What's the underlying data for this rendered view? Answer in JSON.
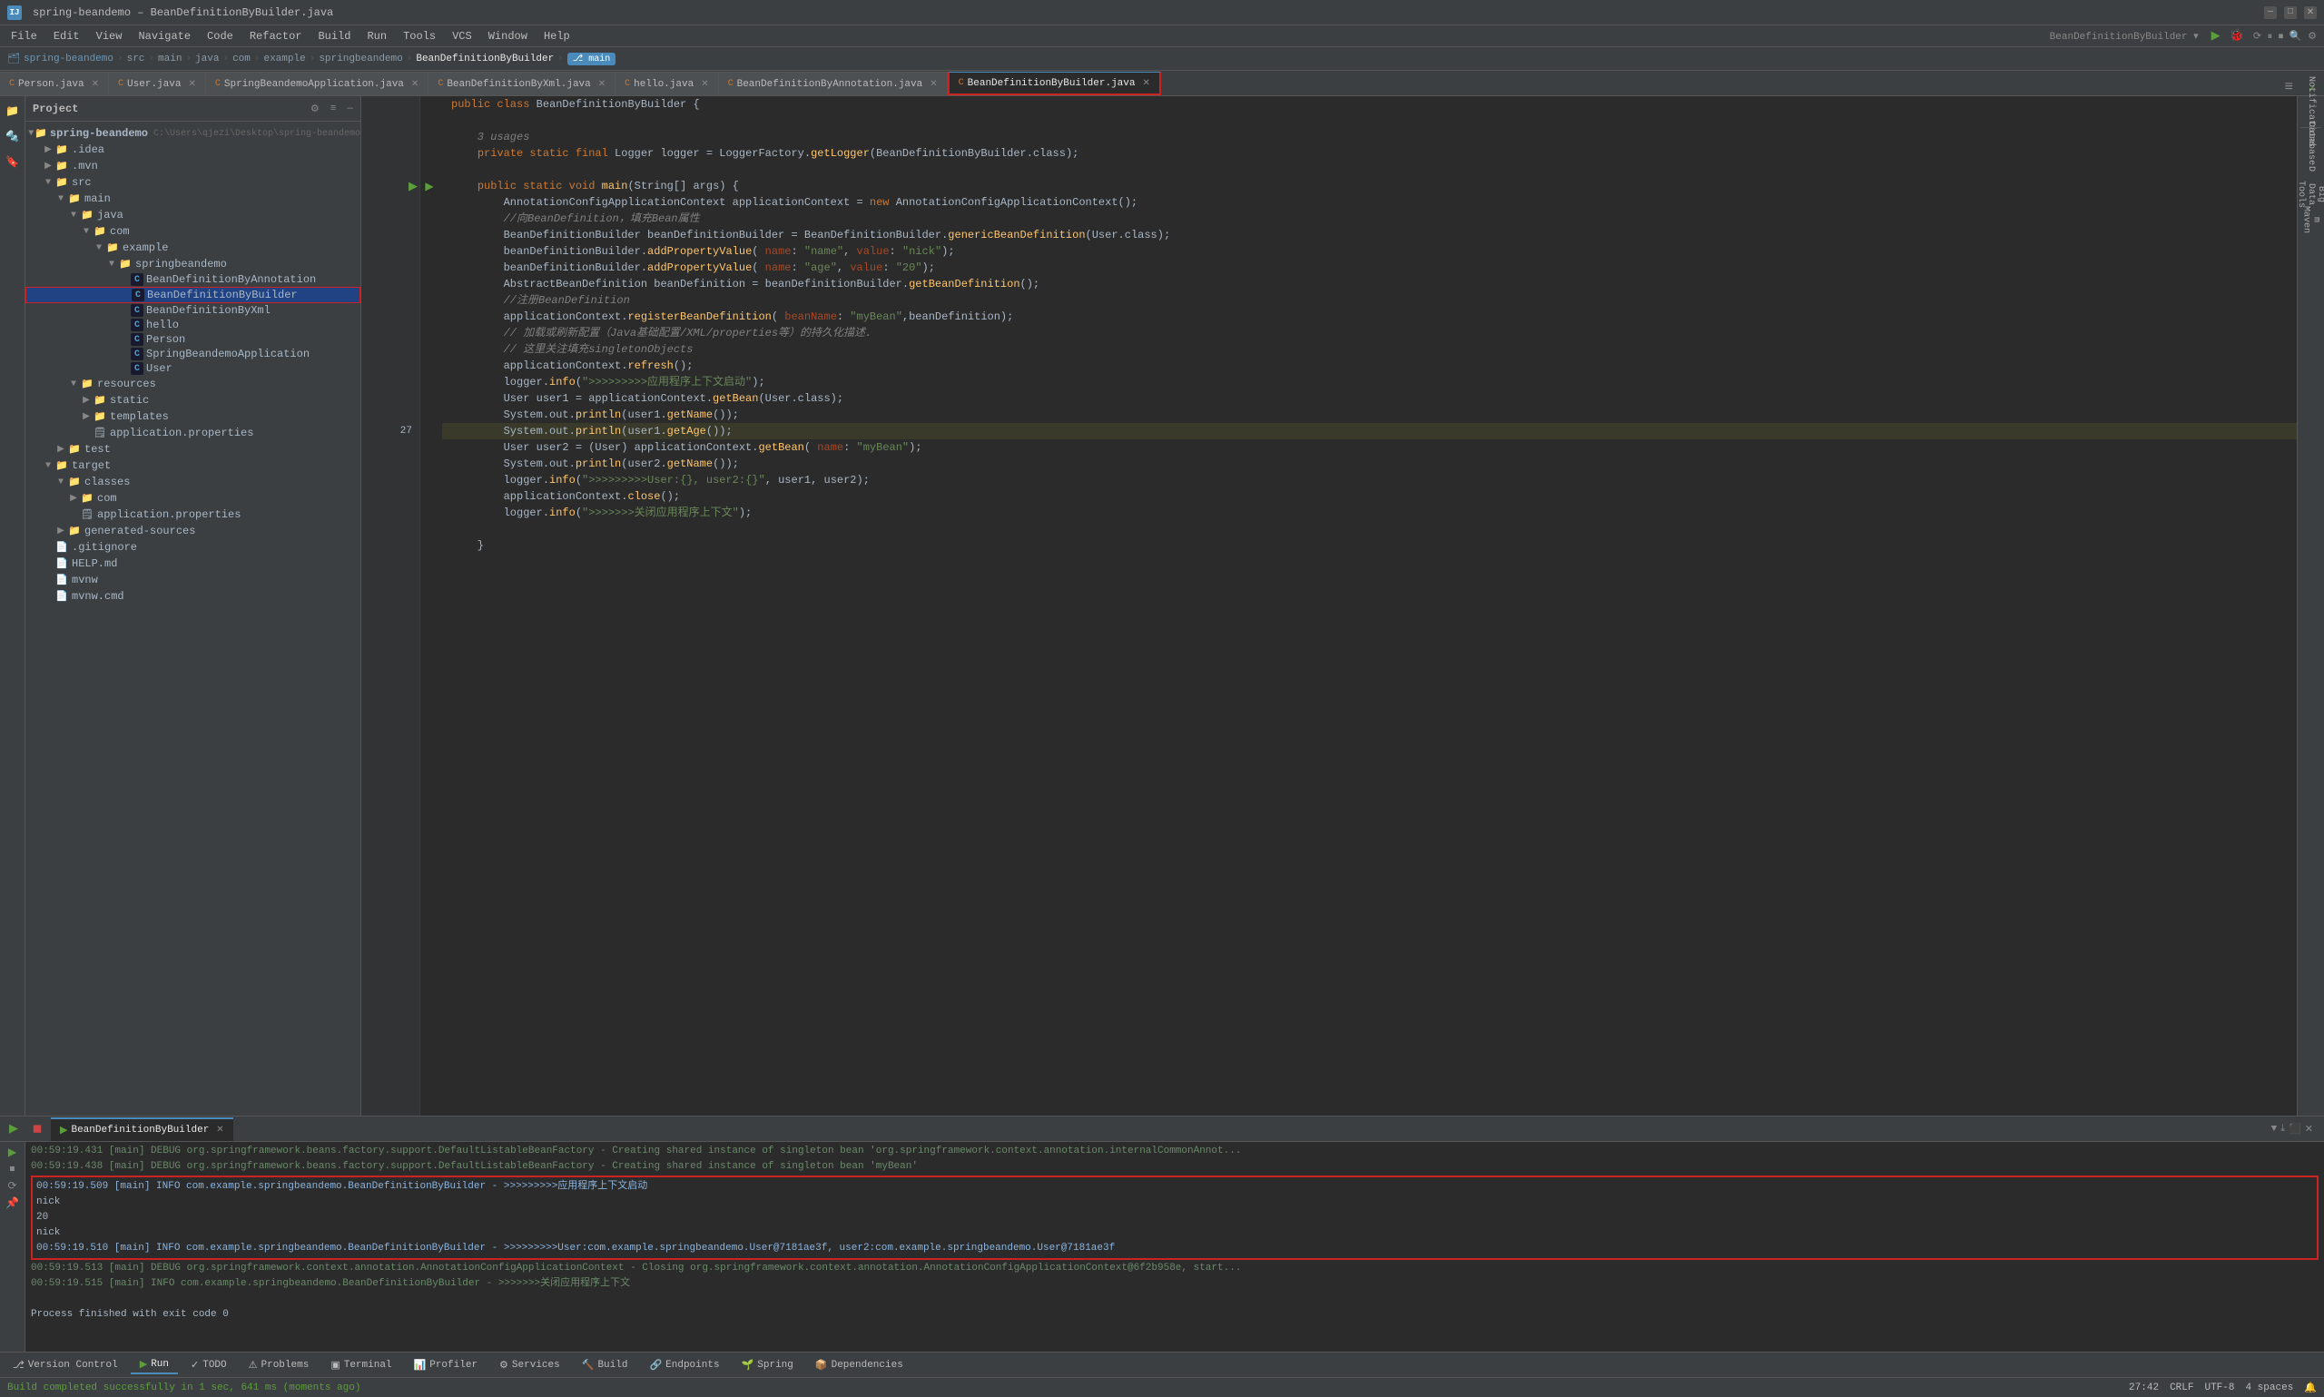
{
  "titlebar": {
    "app_name": "spring-beandemo",
    "file_name": "BeanDefinitionByBuilder.java",
    "title": "spring-beandemo – BeanDefinitionByBuilder.java",
    "minimize": "—",
    "maximize": "□",
    "close": "✕"
  },
  "menubar": {
    "items": [
      "File",
      "Edit",
      "View",
      "Navigate",
      "Code",
      "Refactor",
      "Build",
      "Run",
      "Tools",
      "VCS",
      "Window",
      "Help"
    ]
  },
  "navbar": {
    "path": [
      "spring-beandemo",
      "src",
      "main",
      "java",
      "com",
      "example",
      "springbeandemo"
    ],
    "active": "BeanDefinitionByBuilder",
    "branch": "main"
  },
  "tabs": [
    {
      "label": "Person.java",
      "active": false
    },
    {
      "label": "User.java",
      "active": false
    },
    {
      "label": "SpringBeandemoApplication.java",
      "active": false
    },
    {
      "label": "BeanDefinitionByXml.java",
      "active": false
    },
    {
      "label": "hello.java",
      "active": false
    },
    {
      "label": "BeanDefinitionByAnnotation.java",
      "active": false
    },
    {
      "label": "BeanDefinitionByBuilder.java",
      "active": true
    }
  ],
  "sidebar": {
    "header": "Project",
    "tree": [
      {
        "level": 0,
        "label": "spring-beandemo",
        "type": "root",
        "path": "C:\\Users\\qjezi\\Desktop\\spring-beandemo",
        "expanded": true
      },
      {
        "level": 1,
        "label": ".idea",
        "type": "folder",
        "expanded": false
      },
      {
        "level": 1,
        "label": ".mvn",
        "type": "folder",
        "expanded": false
      },
      {
        "level": 1,
        "label": "src",
        "type": "folder",
        "expanded": true
      },
      {
        "level": 2,
        "label": "main",
        "type": "folder",
        "expanded": true
      },
      {
        "level": 3,
        "label": "java",
        "type": "folder",
        "expanded": true
      },
      {
        "level": 4,
        "label": "com",
        "type": "folder",
        "expanded": true
      },
      {
        "level": 5,
        "label": "example",
        "type": "folder",
        "expanded": true
      },
      {
        "level": 6,
        "label": "springbeandemo",
        "type": "folder",
        "expanded": true
      },
      {
        "level": 7,
        "label": "BeanDefinitionByAnnotation",
        "type": "class",
        "icon": "C"
      },
      {
        "level": 7,
        "label": "BeanDefinitionByBuilder",
        "type": "class",
        "icon": "C",
        "selected": true,
        "focused": true
      },
      {
        "level": 7,
        "label": "BeanDefinitionByXml",
        "type": "class",
        "icon": "C"
      },
      {
        "level": 7,
        "label": "hello",
        "type": "class",
        "icon": "C"
      },
      {
        "level": 7,
        "label": "Person",
        "type": "class",
        "icon": "C"
      },
      {
        "level": 7,
        "label": "SpringBeandemoApplication",
        "type": "class",
        "icon": "C"
      },
      {
        "level": 7,
        "label": "User",
        "type": "class",
        "icon": "C"
      },
      {
        "level": 3,
        "label": "resources",
        "type": "folder",
        "expanded": true
      },
      {
        "level": 4,
        "label": "static",
        "type": "folder",
        "expanded": false
      },
      {
        "level": 4,
        "label": "templates",
        "type": "folder",
        "expanded": false
      },
      {
        "level": 4,
        "label": "application.properties",
        "type": "props"
      },
      {
        "level": 2,
        "label": "test",
        "type": "folder",
        "expanded": false
      },
      {
        "level": 1,
        "label": "target",
        "type": "folder",
        "expanded": true
      },
      {
        "level": 2,
        "label": "classes",
        "type": "folder",
        "expanded": true
      },
      {
        "level": 3,
        "label": "com",
        "type": "folder",
        "expanded": false
      },
      {
        "level": 3,
        "label": "application.properties",
        "type": "props"
      },
      {
        "level": 2,
        "label": "generated-sources",
        "type": "folder",
        "expanded": false
      },
      {
        "level": 1,
        "label": ".gitignore",
        "type": "file"
      },
      {
        "level": 1,
        "label": "HELP.md",
        "type": "file"
      },
      {
        "level": 1,
        "label": "mvnw",
        "type": "file"
      },
      {
        "level": 1,
        "label": "mvnw.cmd",
        "type": "file"
      }
    ]
  },
  "editor": {
    "filename": "BeanDefinitionByBuilder.java",
    "lines": [
      {
        "num": "",
        "content": "public class BeanDefinitionByBuilder {",
        "arrow": false
      },
      {
        "num": "",
        "content": "",
        "arrow": false
      },
      {
        "num": "",
        "content": "    3 usages",
        "arrow": false,
        "comment": true
      },
      {
        "num": "",
        "content": "    private static final Logger logger = LoggerFactory.getLogger(BeanDefinitionByBuilder.class);",
        "arrow": false
      },
      {
        "num": "",
        "content": "",
        "arrow": false
      },
      {
        "num": "",
        "content": "    public static void main(String[] args) {",
        "arrow": true
      },
      {
        "num": "",
        "content": "        AnnotationConfigApplicationContext applicationContext = new AnnotationConfigApplicationContext();",
        "arrow": false
      },
      {
        "num": "",
        "content": "        //向BeanDefinition，填充Bean属性",
        "arrow": false,
        "comment": true
      },
      {
        "num": "",
        "content": "        BeanDefinitionBuilder beanDefinitionBuilder = BeanDefinitionBuilder.genericBeanDefinition(User.class);",
        "arrow": false
      },
      {
        "num": "",
        "content": "        beanDefinitionBuilder.addPropertyValue( name: \"name\", value: \"nick\");",
        "arrow": false
      },
      {
        "num": "",
        "content": "        beanDefinitionBuilder.addPropertyValue( name: \"age\", value: \"20\");",
        "arrow": false
      },
      {
        "num": "",
        "content": "        AbstractBeanDefinition beanDefinition = beanDefinitionBuilder.getBeanDefinition();",
        "arrow": false
      },
      {
        "num": "",
        "content": "        //注册BeanDefinition",
        "arrow": false,
        "comment": true
      },
      {
        "num": "",
        "content": "        applicationContext.registerBeanDefinition( beanName: \"myBean\",beanDefinition);",
        "arrow": false
      },
      {
        "num": "",
        "content": "        // 加载或刷新配置（Java基础配置/XML/properties等）的持久化描述.",
        "arrow": false,
        "comment": true
      },
      {
        "num": "",
        "content": "        // 这里关注填充singletonObjects",
        "arrow": false,
        "comment": true
      },
      {
        "num": "",
        "content": "        applicationContext.refresh();",
        "arrow": false
      },
      {
        "num": "",
        "content": "        logger.info(\">>>>>>>>>应用程序上下文启动\");",
        "arrow": false
      },
      {
        "num": "",
        "content": "        User user1 = applicationContext.getBean(User.class);",
        "arrow": false
      },
      {
        "num": "",
        "content": "        System.out.println(user1.getName());",
        "arrow": false
      },
      {
        "num": "27",
        "content": "        System.out.println(user1.getAge());",
        "arrow": false,
        "highlight": true
      },
      {
        "num": "",
        "content": "        User user2 = (User) applicationContext.getBean( name: \"myBean\");",
        "arrow": false
      },
      {
        "num": "",
        "content": "        System.out.println(user2.getName());",
        "arrow": false
      },
      {
        "num": "",
        "content": "        logger.info(\">>>>>>>>>User:{}, user2:{}\", user1, user2);",
        "arrow": false
      },
      {
        "num": "",
        "content": "        applicationContext.close();",
        "arrow": false
      },
      {
        "num": "",
        "content": "        logger.info(\">>>>>>>关闭应用程序上下文\");",
        "arrow": false
      },
      {
        "num": "",
        "content": "",
        "arrow": false
      },
      {
        "num": "",
        "content": "    }",
        "arrow": false
      }
    ]
  },
  "run_panel": {
    "tab_label": "BeanDefinitionByBuilder",
    "log_lines": [
      {
        "text": "00:59:19.431 [main] DEBUG org.springframework.beans.factory.support.DefaultListableBeanFactory - Creating shared instance of singleton bean 'org.springframework.context.annotation.internalCommonAnnot...",
        "type": "debug"
      },
      {
        "text": "00:59:19.438 [main] DEBUG org.springframework.beans.factory.support.DefaultListableBeanFactory - Creating shared instance of singleton bean 'myBean'",
        "type": "debug"
      },
      {
        "text": "00:59:19.509 [main] INFO com.example.springbeandemo.BeanDefinitionByBuilder - >>>>>>>>>应用程序上下文启动",
        "type": "info",
        "highlight": true
      },
      {
        "text": "nick",
        "type": "output",
        "highlight": true
      },
      {
        "text": "20",
        "type": "output",
        "highlight": true
      },
      {
        "text": "nick",
        "type": "output",
        "highlight": true
      },
      {
        "text": "00:59:19.510 [main] INFO com.example.springbeandemo.BeanDefinitionByBuilder - >>>>>>>>>User:com.example.springbeandemo.User@7181ae3f, user2:com.example.springbeandemo.User@7181ae3f",
        "type": "info",
        "highlight": true
      },
      {
        "text": "00:59:19.513 [main] DEBUG org.springframework.context.annotation.AnnotationConfigApplicationContext - Closing org.springframework.context.annotation.AnnotationConfigApplicationContext@6f2b958e, start...",
        "type": "debug"
      },
      {
        "text": "00:59:19.515 [main] INFO com.example.springbeandemo.BeanDefinitionByBuilder - >>>>>>>关闭应用程序上下文",
        "type": "debug"
      },
      {
        "text": "",
        "type": "blank"
      },
      {
        "text": "Process finished with exit code 0",
        "type": "output"
      }
    ]
  },
  "bottom_toolbar": {
    "items": [
      "Version Control",
      "Run",
      "TODO",
      "Problems",
      "Terminal",
      "Profiler",
      "Services",
      "Build",
      "Endpoints",
      "Spring",
      "Dependencies"
    ]
  },
  "statusbar": {
    "build_msg": "Build completed successfully in 1 sec, 641 ms (moments ago)",
    "line_col": "27:42",
    "line_ending": "CRLF",
    "encoding": "UTF-8",
    "indent": "4",
    "right_extra": "4 spaces"
  },
  "right_sidebar": {
    "items": [
      "Notifications",
      "Database",
      "D",
      "Big Data Tools",
      "m",
      "Maven"
    ]
  }
}
